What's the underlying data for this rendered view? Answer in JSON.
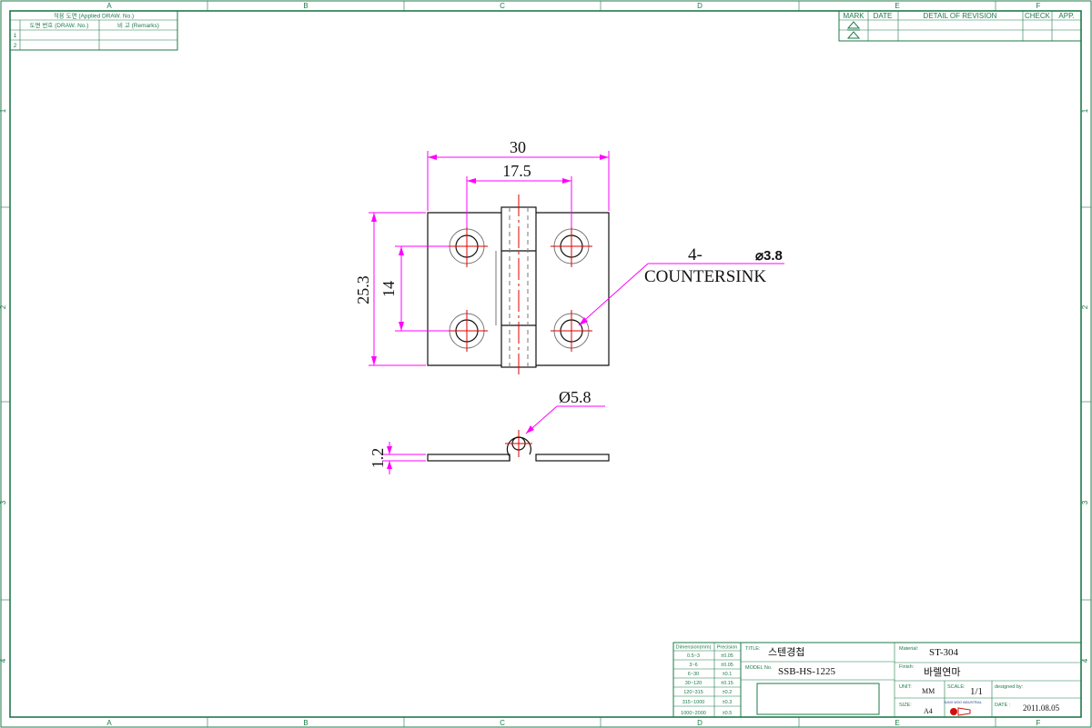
{
  "colors": {
    "frame": "#1e7a4a",
    "dimension": "#ff00ff",
    "centerline": "#e00000",
    "part": "#111111"
  },
  "zones": {
    "columns": [
      "A",
      "B",
      "C",
      "D",
      "E",
      "F"
    ],
    "rows": [
      "1",
      "2",
      "3",
      "4"
    ]
  },
  "applied_drawing_table": {
    "title": "적용 도면 (Applied DRAW. No.)",
    "col_drawing_no": "도면 번호 (DRAW. No.)",
    "col_remarks": "비 고 (Remarks)",
    "rows": [
      "1",
      "2"
    ]
  },
  "revision_table": {
    "headers": {
      "mark": "MARK",
      "date": "DATE",
      "detail": "DETAIL OF REVISION",
      "check": "CHECK",
      "app": "APP."
    }
  },
  "dimensions": {
    "overall_width": "30",
    "hole_spacing_x": "17.5",
    "overall_height": "25.3",
    "hole_spacing_y": "14",
    "hole_note_qty": "4-",
    "hole_note_dia": "⌀3.8",
    "hole_note_type": "COUNTERSINK",
    "pin_diameter": "Ø5.8",
    "thickness": "1.2"
  },
  "tolerance_table": {
    "header_dimension": "Dimension(mm)",
    "header_precision": "Precision",
    "rows": [
      {
        "range": "0.5~3",
        "tol": "±0.05"
      },
      {
        "range": "3~6",
        "tol": "±0.05"
      },
      {
        "range": "6~30",
        "tol": "±0.1"
      },
      {
        "range": "30~120",
        "tol": "±0.15"
      },
      {
        "range": "120~315",
        "tol": "±0.2"
      },
      {
        "range": "315~1000",
        "tol": "±0.3"
      },
      {
        "range": "1000~2000",
        "tol": "±0.5"
      }
    ]
  },
  "title_block": {
    "title_label": "TITLE:",
    "title_value": "스텐경첩",
    "model_label": "MODEL No.",
    "model_value": "SSB-HS-1225",
    "material_label": "Material:",
    "material_value": "ST-304",
    "finish_label": "Finish:",
    "finish_value": "바렐연마",
    "unit_label": "UNIT:",
    "unit_value": "MM",
    "scale_label": "SCALE:",
    "scale_value": "1/1",
    "designed_label": "designed by:",
    "size_label": "SIZE:",
    "size_value": "A4",
    "date_label": "DATE :",
    "date_value": "2011.08.05",
    "logo_text": "SUNG WOO INDUSTRIAL"
  }
}
